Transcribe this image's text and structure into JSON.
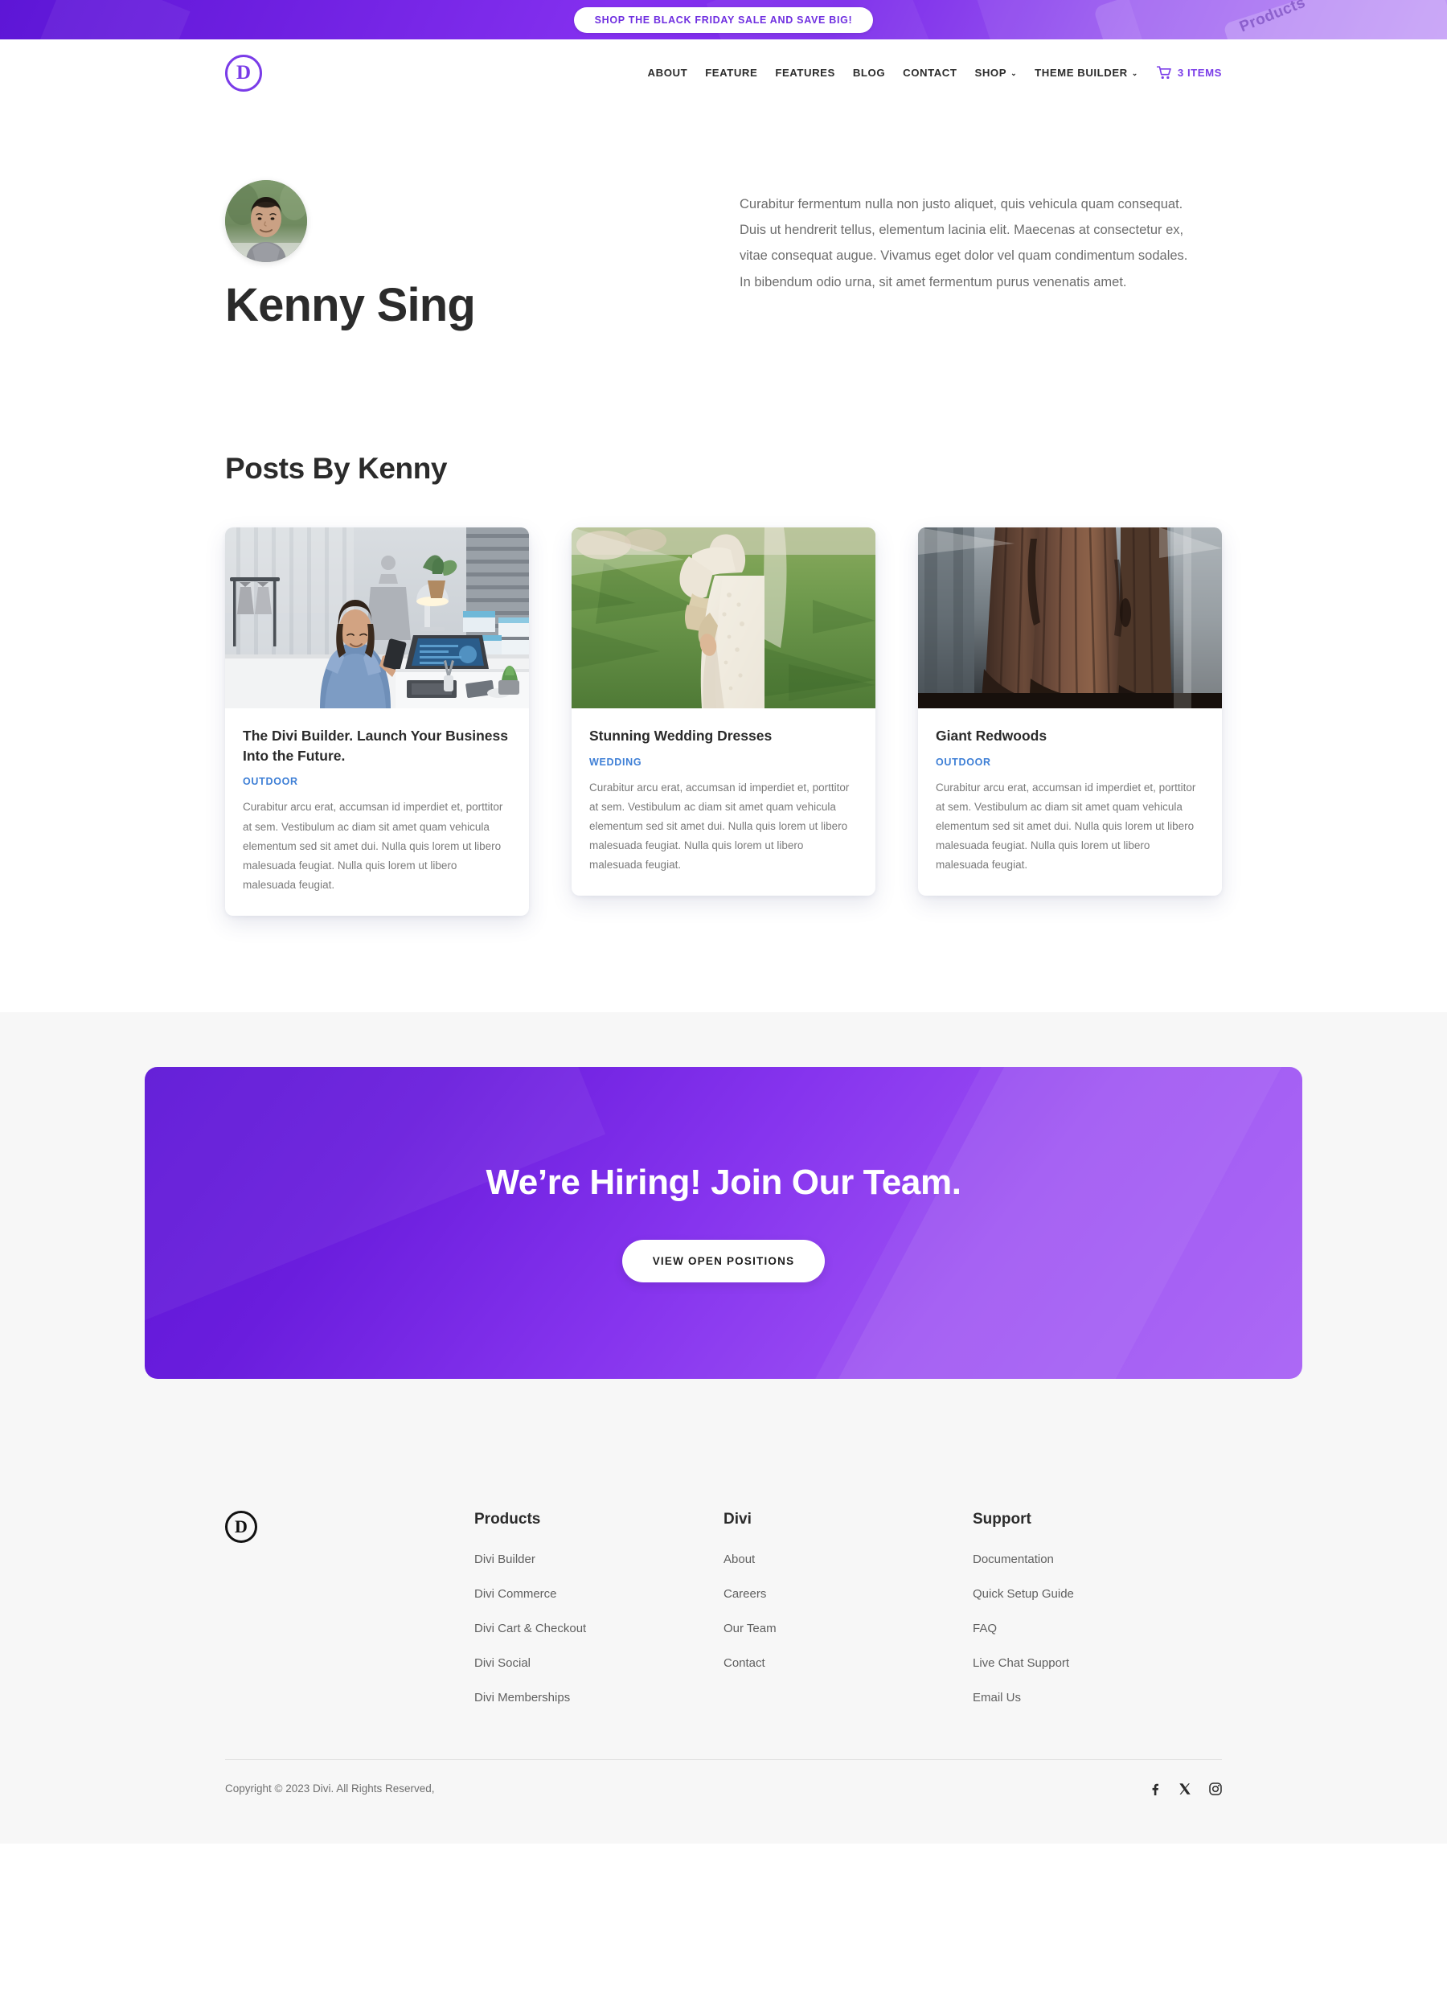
{
  "promo": {
    "text": "SHOP THE BLACK FRIDAY SALE AND SAVE BIG!",
    "decor_word": "Products",
    "background_color": "#7c2bea",
    "text_color": "#6f2fe0"
  },
  "header": {
    "logo_letter": "D",
    "logo_color": "#7a3ce8",
    "nav": [
      {
        "label": "ABOUT",
        "has_caret": false
      },
      {
        "label": "FEATURE",
        "has_caret": false
      },
      {
        "label": "FEATURES",
        "has_caret": false
      },
      {
        "label": "BLOG",
        "has_caret": false
      },
      {
        "label": "CONTACT",
        "has_caret": false
      },
      {
        "label": "SHOP",
        "has_caret": true
      },
      {
        "label": "THEME BUILDER",
        "has_caret": true
      }
    ],
    "caret_glyph": "⌄",
    "cart": {
      "icon": "shopping-cart-icon",
      "label": "3 ITEMS",
      "color": "#7a3ce8"
    }
  },
  "author": {
    "avatar_alt": "Portrait photo of Kenny Sing",
    "name": "Kenny Sing",
    "bio": "Curabitur fermentum nulla non justo aliquet, quis vehicula quam consequat. Duis ut hendrerit tellus, elementum lacinia elit. Maecenas at consectetur ex, vitae consequat augue. Vivamus eget dolor vel quam condimentum sodales. In bibendum odio urna, sit amet fermentum purus venenatis amet."
  },
  "posts": {
    "section_title": "Posts By Kenny",
    "category_color": "#3e7fd6",
    "items": [
      {
        "image_alt": "Woman smiling at her phone beside a laptop in a clothing studio",
        "title": "The Divi Builder. Launch Your Business Into the Future.",
        "category": "OUTDOOR",
        "excerpt": "Curabitur arcu erat, accumsan id imperdiet et, porttitor at sem. Vestibulum ac diam sit amet quam vehicula elementum sed sit amet dui. Nulla quis lorem ut libero malesuada feugiat. Nulla quis lorem ut libero malesuada feugiat."
      },
      {
        "image_alt": "Bride in a white lace gown standing on green grass",
        "title": "Stunning Wedding Dresses",
        "category": "WEDDING",
        "excerpt": "Curabitur arcu erat, accumsan id imperdiet et, porttitor at sem. Vestibulum ac diam sit amet quam vehicula elementum sed sit amet dui. Nulla quis lorem ut libero malesuada feugiat. Nulla quis lorem ut libero malesuada feugiat."
      },
      {
        "image_alt": "Giant redwood tree trunks in a misty forest",
        "title": "Giant Redwoods",
        "category": "OUTDOOR",
        "excerpt": "Curabitur arcu erat, accumsan id imperdiet et, porttitor at sem. Vestibulum ac diam sit amet quam vehicula elementum sed sit amet dui. Nulla quis lorem ut libero malesuada feugiat. Nulla quis lorem ut libero malesuada feugiat."
      }
    ]
  },
  "cta": {
    "title": "We’re Hiring! Join Our Team.",
    "button_label": "VIEW OPEN POSITIONS",
    "background_color": "#8634ee"
  },
  "footer": {
    "logo_letter": "D",
    "columns": [
      {
        "heading": "Products",
        "links": [
          "Divi Builder",
          "Divi Commerce",
          "Divi Cart & Checkout",
          "Divi Social",
          "Divi Memberships"
        ]
      },
      {
        "heading": "Divi",
        "links": [
          "About",
          "Careers",
          "Our Team",
          "Contact"
        ]
      },
      {
        "heading": "Support",
        "links": [
          "Documentation",
          "Quick Setup Guide",
          "FAQ",
          "Live Chat Support",
          "Email Us"
        ]
      }
    ],
    "copyright": "Copyright © 2023 Divi. All Rights Reserved,",
    "socials": [
      "facebook-icon",
      "x-twitter-icon",
      "instagram-icon"
    ]
  }
}
